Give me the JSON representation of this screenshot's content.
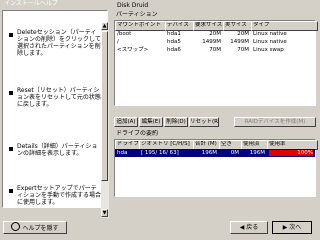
{
  "left_panel": {
    "title": "インストールヘルプ",
    "items": [
      {
        "text": "Deleteセッション（パーティションの削除）をクリックして選択されたパーティションを削除します。"
      },
      {
        "text": "Reset（リセット）パーティション表をリセットして元の状態に戻します。"
      },
      {
        "text": "Details（詳細）パーティションの詳細を表示します。"
      },
      {
        "text": "Expertセットアップでパーティションを手動で作成する場合に使用します。"
      }
    ],
    "help_button": "ヘルプを隠す"
  },
  "right_panel": {
    "title": "Disk Druid",
    "partitions_group_label": "パーティション",
    "partition_columns": [
      "マウントポイント",
      "デバイス",
      "要求サイズ",
      "実サイズ",
      "タイプ"
    ],
    "partitions": [
      {
        "mount": "/boot",
        "device": "hda1",
        "requested": "20M",
        "actual": "20M",
        "type": "Linux native"
      },
      {
        "mount": "/",
        "device": "hda5",
        "requested": "1499M",
        "actual": "1499M",
        "type": "Linux native"
      },
      {
        "mount": "<スワップ>",
        "device": "hda6",
        "requested": "70M",
        "actual": "70M",
        "type": "Linux swap"
      }
    ],
    "action_buttons": [
      {
        "label": "追加(A)",
        "enabled": true
      },
      {
        "label": "編集(E)",
        "enabled": true
      },
      {
        "label": "削除(D)",
        "enabled": true
      },
      {
        "label": "リセット(R)",
        "enabled": true
      },
      {
        "label": "RAIDデバイスを作成(M)",
        "enabled": false
      }
    ],
    "drive_group_label": "ドライブの要約",
    "drive_columns": [
      "ドライブ",
      "ジオメトリ [C/H/S]",
      "合計 (M)",
      "空き",
      "使用済",
      "使用率"
    ],
    "drives": [
      {
        "drive": "hda",
        "geometry": "[ 195/ 16/ 63]",
        "total": "196M",
        "free": "0M",
        "used": "196M",
        "percent": "100%"
      }
    ]
  },
  "nav": {
    "back_label": "戻る",
    "next_label": "次へ"
  }
}
